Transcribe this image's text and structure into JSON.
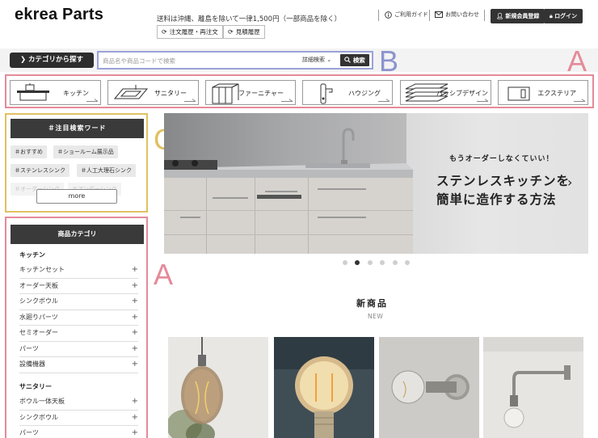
{
  "header": {
    "logo": "ekrea Parts",
    "shipping": "送料は沖縄、離島を除いて一律1,500円（一部商品を除く）",
    "order_history": "注文履歴・再注文",
    "quote_history": "見積履歴",
    "guide": "ご利用ガイド",
    "contact": "お問い合わせ",
    "register": "新規会員登録",
    "login": "ログイン"
  },
  "search": {
    "category_button": "カテゴリから探す",
    "placeholder": "商品名や商品コードで検索",
    "advanced": "詳細検索",
    "button": "検索"
  },
  "annotations": {
    "a_top": "A",
    "b": "B",
    "c": "C",
    "a_left": "A"
  },
  "categories": [
    {
      "label": "キッチン",
      "icon": "kitchen-icon"
    },
    {
      "label": "サニタリー",
      "icon": "sink-icon"
    },
    {
      "label": "ファーニチャー",
      "icon": "furniture-icon"
    },
    {
      "label": "ハウジング",
      "icon": "door-handle-icon"
    },
    {
      "label": "パッシブデザイン",
      "icon": "louver-icon"
    },
    {
      "label": "エクステリア",
      "icon": "window-frame-icon"
    }
  ],
  "keywords": {
    "title": "＃注目検索ワード",
    "tags": [
      "＃おすすめ",
      "＃ショールーム展示品",
      "＃ステンレスシンク",
      "＃人工大理石シンク",
      "＃オーダーシンク",
      "＃アンダーシンク"
    ],
    "more": "more"
  },
  "product_categories": {
    "title": "商品カテゴリ",
    "sections": [
      {
        "title": "キッチン",
        "items": [
          "キッチンセット",
          "オーダー天板",
          "シンクボウル",
          "水廻りパーツ",
          "セミオーダー",
          "パーツ",
          "設備機器"
        ]
      },
      {
        "title": "サニタリー",
        "items": [
          "ボウル一体天板",
          "シンクボウル",
          "パーツ"
        ]
      }
    ]
  },
  "hero": {
    "sub": "もうオーダーしなくていい！",
    "line1": "ステンレスキッチンを",
    "line2": "簡単に造作する方法",
    "arrow": "›"
  },
  "carousel": {
    "count": 6,
    "active": 1
  },
  "new_section": {
    "title": "新商品",
    "sub": "NEW"
  },
  "products": [
    "bulb-pendant-1",
    "bulb-pendant-2",
    "wall-lamp-1",
    "wall-lamp-2"
  ],
  "colors": {
    "accent_pink": "#e58a99",
    "accent_blue": "#9aa3d8",
    "accent_gold": "#e1c062",
    "dark": "#333333"
  }
}
